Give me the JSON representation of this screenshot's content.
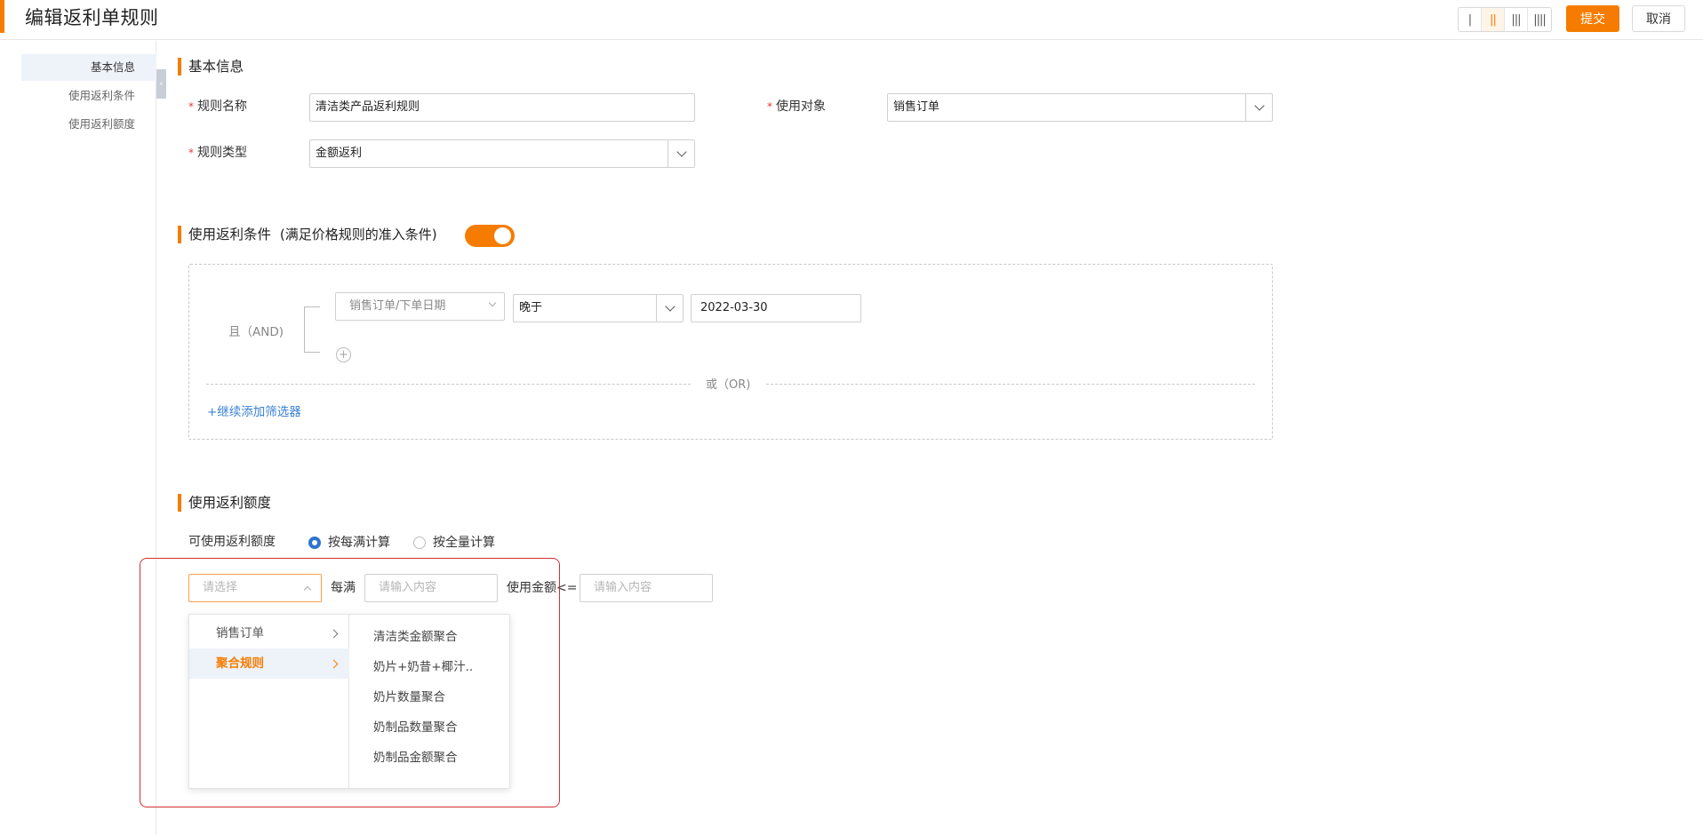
{
  "header": {
    "title": "编辑返利单规则",
    "layout_buttons": [
      "|",
      "||",
      "|||",
      "||||"
    ],
    "submit_label": "提交",
    "cancel_label": "取消",
    "accent_color": "#f57c00"
  },
  "sidebar": {
    "items": [
      {
        "label": "基本信息",
        "active": true
      },
      {
        "label": "使用返利条件",
        "active": false
      },
      {
        "label": "使用返利额度",
        "active": false
      }
    ]
  },
  "basic_info": {
    "title": "基本信息",
    "rule_name": {
      "label": "规则名称",
      "value": "清洁类产品返利规则"
    },
    "target": {
      "label": "使用对象",
      "value": "销售订单"
    },
    "rule_type": {
      "label": "规则类型",
      "value": "金额返利"
    }
  },
  "conditions": {
    "title": "使用返利条件",
    "subtitle": "(满足价格规则的准入条件)",
    "toggle_on": true,
    "and_label": "且（AND)",
    "field_select": "销售订单/下单日期",
    "operator_select": "晚于",
    "date_value": "2022-03-30",
    "or_label": "或（OR)",
    "add_filter": "+继续添加筛选器"
  },
  "quota": {
    "title": "使用返利额度",
    "available_label": "可使用返利额度",
    "radio_options": [
      {
        "label": "按每满计算",
        "checked": true
      },
      {
        "label": "按全量计算",
        "checked": false
      }
    ],
    "select_placeholder": "请选择",
    "per_label": "每满",
    "per_placeholder": "请输入内容",
    "amount_label": "使用金额<=",
    "amount_placeholder": "请输入内容"
  },
  "cascader": {
    "level1": [
      {
        "label": "销售订单",
        "active": false
      },
      {
        "label": "聚合规则",
        "active": true
      }
    ],
    "level2": [
      "清洁类金额聚合",
      "奶片+奶昔+椰汁..",
      "奶片数量聚合",
      "奶制品数量聚合",
      "奶制品金额聚合"
    ]
  }
}
